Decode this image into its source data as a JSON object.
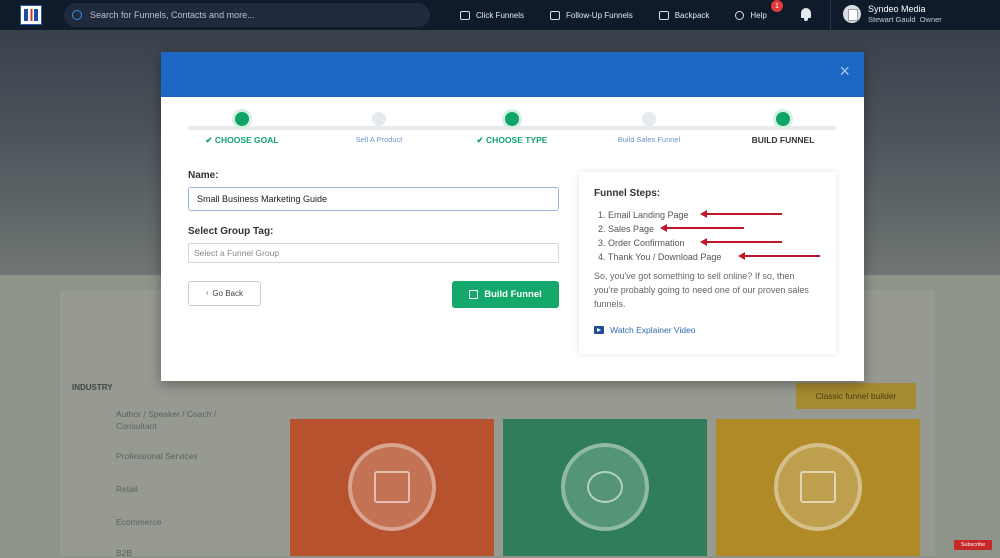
{
  "topbar": {
    "search_placeholder": "Search for Funnels, Contacts and more...",
    "nav": [
      "Click Funnels",
      "Follow-Up Funnels",
      "Backpack",
      "Help"
    ],
    "help_badge": "1",
    "account_name": "Syndeo Media",
    "account_user": "Stewart Gauld",
    "account_role": "Owner"
  },
  "background": {
    "industry_label": "INDUSTRY",
    "industries": [
      "Author / Speaker / Coach / Consultant",
      "Professional Services",
      "Retail",
      "Ecommerce",
      "B2B"
    ],
    "classic_button": "Classic funnel builder",
    "card_colors": [
      "#b6532e",
      "#2f7d59",
      "#b08a26"
    ]
  },
  "modal": {
    "steps": [
      {
        "label": "CHOOSE GOAL",
        "state": "done"
      },
      {
        "label": "Sell A Product",
        "state": "todo"
      },
      {
        "label": "CHOOSE TYPE",
        "state": "done"
      },
      {
        "label": "Build Sales Funnel",
        "state": "todo"
      },
      {
        "label": "BUILD FUNNEL",
        "state": "current"
      }
    ],
    "name_label": "Name:",
    "name_value": "Small Business Marketing Guide",
    "group_label": "Select Group Tag:",
    "group_placeholder": "Select a Funnel Group",
    "back_button": "Go Back",
    "build_button": "Build Funnel",
    "info": {
      "title": "Funnel Steps:",
      "steps": [
        "1. Email Landing Page",
        "2. Sales Page",
        "3. Order Confirmation",
        "4. Thank You / Download Page"
      ],
      "description": "So, you've got something to sell online? If so, then you're probably going to need one of our proven sales funnels.",
      "video_link": "Watch Explainer Video"
    }
  },
  "colors": {
    "accent_blue": "#1d67c4",
    "success_green": "#14a86a",
    "annotation_red": "#c0162b"
  },
  "youtube_badge": "Subscribe"
}
